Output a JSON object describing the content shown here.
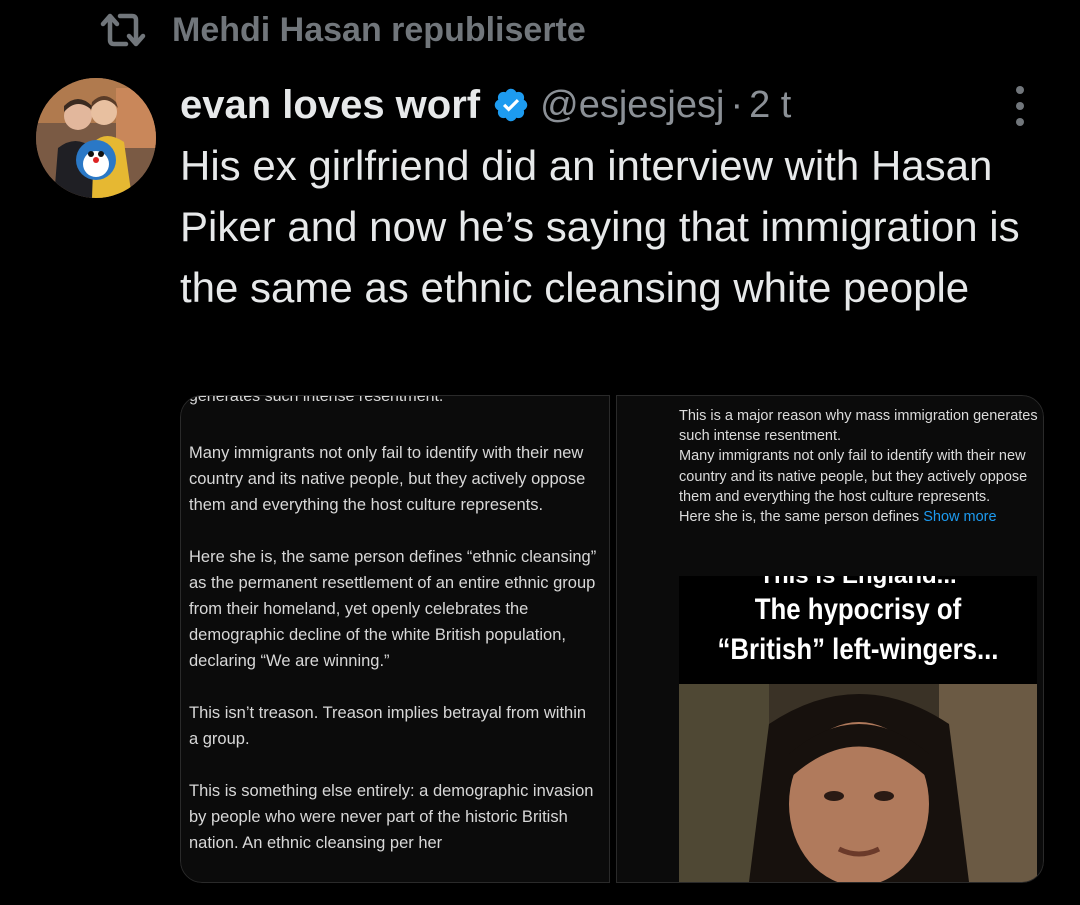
{
  "repost": {
    "label": "Mehdi Hasan republiserte",
    "icon": "repost-icon"
  },
  "tweet": {
    "author_name": "evan loves worf",
    "verified_icon": "verified-badge-icon",
    "handle": "@esjesjesj",
    "separator": "·",
    "time": "2 t",
    "more_icon": "more-options-icon",
    "text": "His ex girlfriend did an interview with Hasan Piker and now he’s saying that immigration is the same as ethnic cleansing white people"
  },
  "media": {
    "left": {
      "cut_line": "generates such intense resentment.",
      "paragraphs": [
        "Many immigrants not only fail to identify with their new country and its native people, but they actively oppose them and everything the host culture represents.",
        "Here she is, the same person defines “ethnic cleansing” as the permanent resettlement of an entire ethnic group from their homeland, yet openly celebrates the demographic decline of the white British population, declaring “We are winning.”",
        "This isn’t treason. Treason implies betrayal from within a group.",
        "This is something else entirely: a demographic invasion by people who were never part of the historic British nation. An ethnic cleansing per her"
      ]
    },
    "right": {
      "caption_lines": [
        "This is a major reason why mass immigration generates such intense resentment.",
        "Many immigrants not only fail to identify with their new country and its native people, but they actively oppose them and everything the host culture represents.",
        "Here she is, the same person defines"
      ],
      "show_more": "Show more",
      "video_cut_line": "This is England...",
      "video_title": "The hypocrisy of “British” left-wingers..."
    }
  },
  "colors": {
    "background": "#000000",
    "text": "#e7e9ea",
    "muted": "#71767b",
    "verified": "#1d9bf0",
    "link": "#1d9bf0"
  }
}
